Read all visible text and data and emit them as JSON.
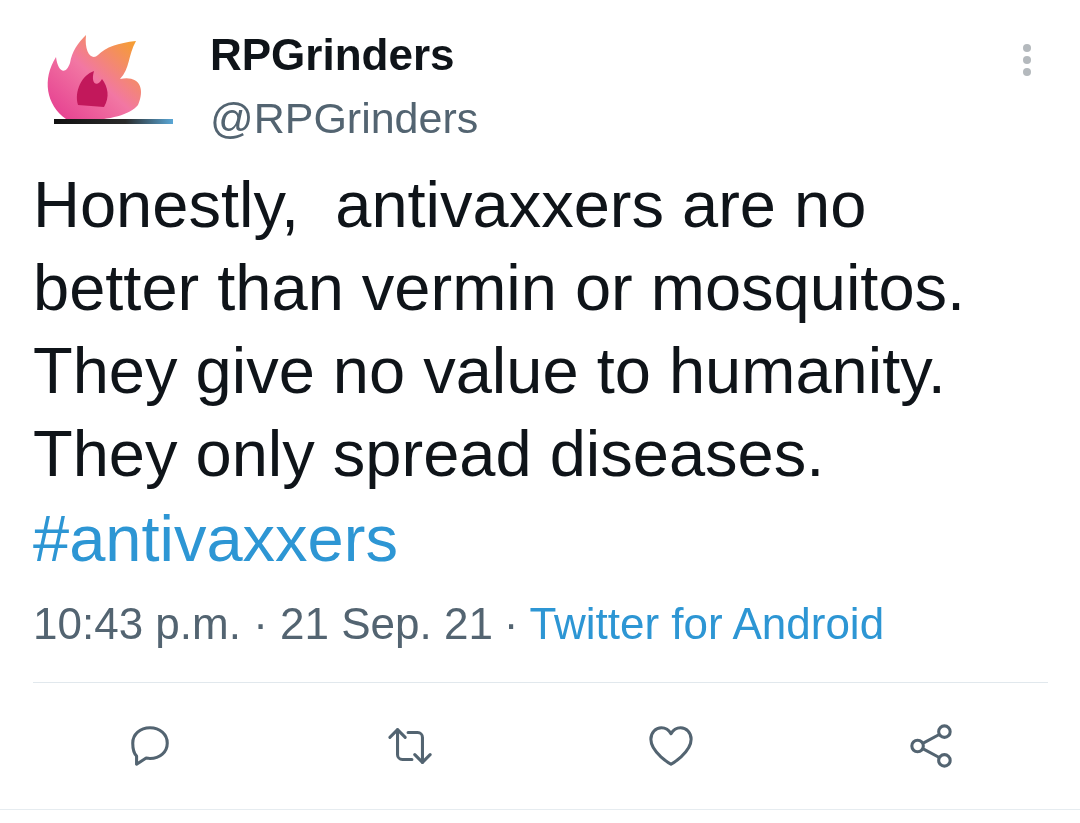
{
  "author": {
    "name": "RPGrinders",
    "handle": "@RPGrinders"
  },
  "tweet": {
    "text": "Honestly,  antivaxxers are no better than vermin or mosquitos. They give no value to humanity. They only spread diseases.",
    "hashtags": [
      "#antivaxxers"
    ]
  },
  "meta": {
    "posted": "10:43 p.m. · 21 Sep. 21",
    "separator": "·",
    "source": "Twitter for Android"
  }
}
